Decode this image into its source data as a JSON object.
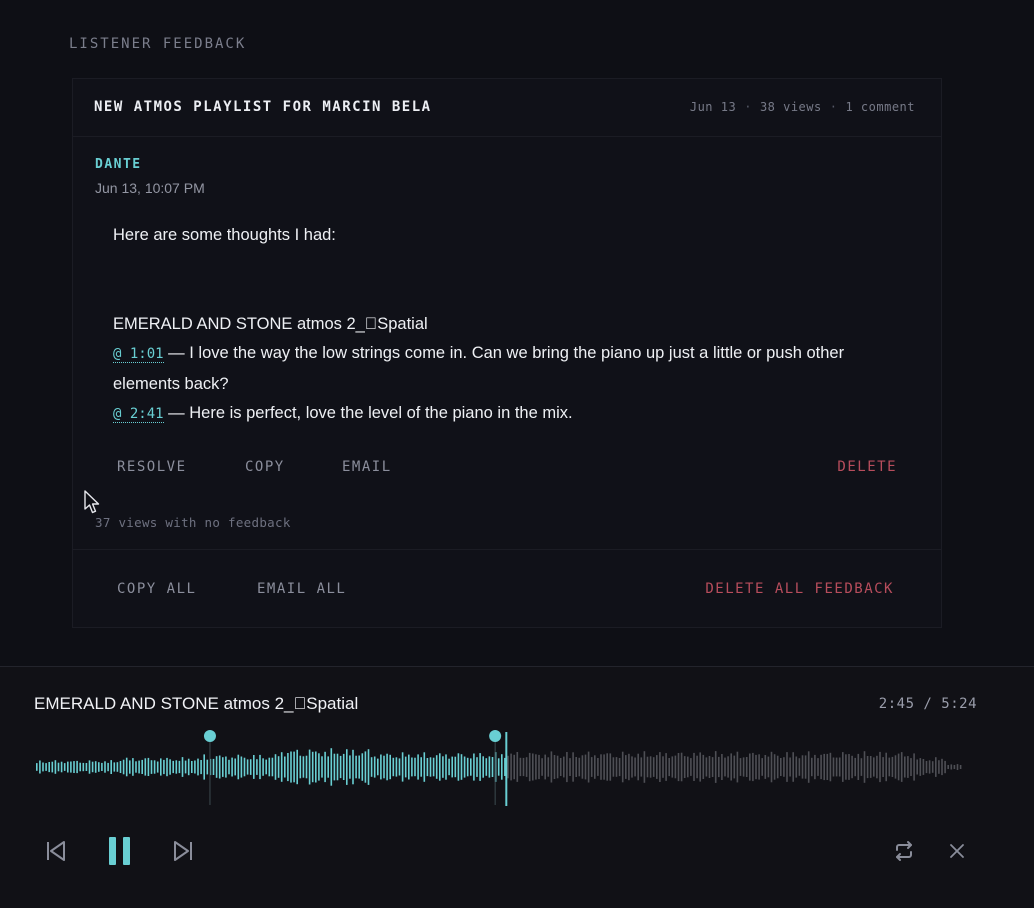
{
  "feedback": {
    "heading": "LISTENER FEEDBACK",
    "card": {
      "title": "NEW ATMOS PLAYLIST FOR MARCIN BELA",
      "meta": {
        "date": "Jun 13",
        "views": "38 views",
        "comments": "1 comment"
      },
      "comment": {
        "author": "DANTE",
        "date": "Jun 13, 10:07 PM",
        "intro": "Here are some thoughts I had:",
        "track": "EMERALD AND STONE atmos 2_Spatial",
        "notes": [
          {
            "timestamp": "@ 1:01",
            "text": " — I love the way the low strings come in. Can we bring the piano up just a little or push other elements back?"
          },
          {
            "timestamp": "@ 2:41",
            "text": " — Here is perfect, love the level of the piano in the mix."
          }
        ],
        "actions": {
          "resolve": "RESOLVE",
          "copy": "COPY",
          "email": "EMAIL",
          "delete": "DELETE"
        }
      },
      "no_feedback": "37 views with no feedback",
      "footer": {
        "copy_all": "COPY ALL",
        "email_all": "EMAIL ALL",
        "delete_all": "DELETE ALL FEEDBACK"
      }
    }
  },
  "player": {
    "track_title": "EMERALD AND STONE atmos 2_Spatial",
    "elapsed": "2:45",
    "duration": "5:24",
    "time_display": "2:45 / 5:24",
    "progress_fraction": 0.509,
    "marker_times": [
      "1:01",
      "2:41"
    ],
    "icons": {
      "prev": "skip-previous-icon",
      "pause": "pause-icon",
      "next": "skip-next-icon",
      "repeat": "repeat-icon",
      "close": "close-icon"
    }
  },
  "colors": {
    "accent": "#69cfd3",
    "danger": "#b74d5c",
    "background": "#0e0f15",
    "player_background": "#111116",
    "wave_unplayed": "#4e4f55"
  }
}
